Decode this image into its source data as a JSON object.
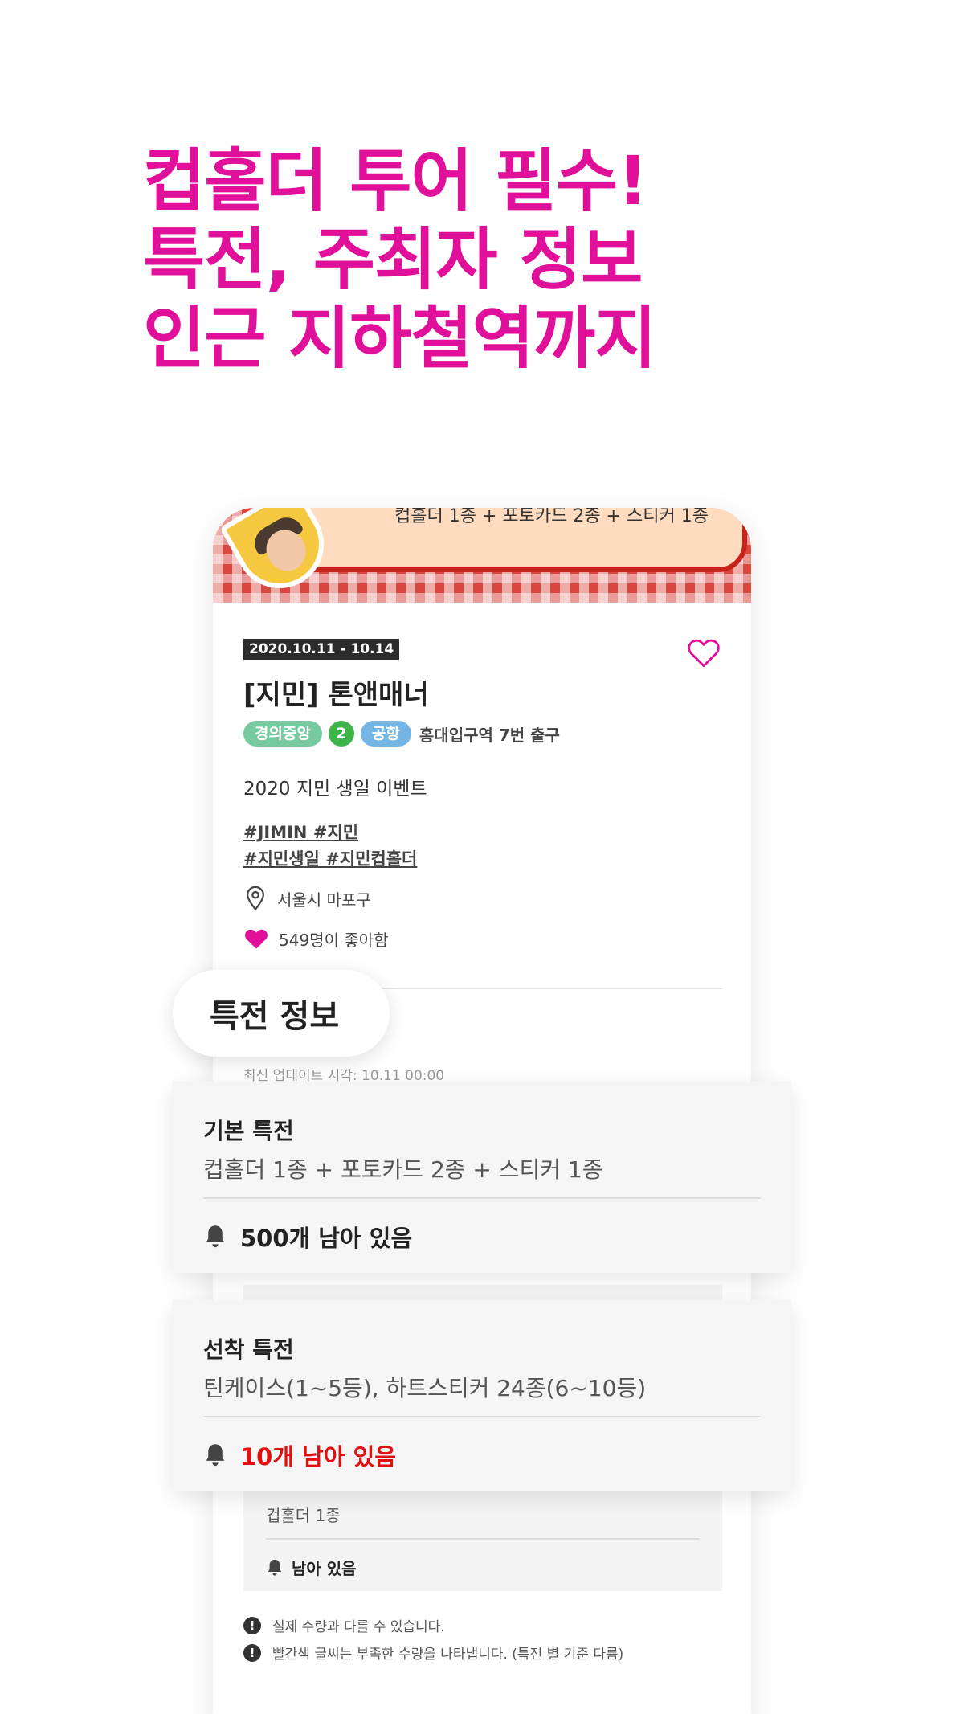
{
  "headline": {
    "lines": [
      "컵홀더 투어 필수!",
      "특전, 주최자 정보",
      "인근 지하철역까지"
    ],
    "color": "#e0109b"
  },
  "banner": {
    "text": "컵홀더 1종 + 포토카드 2종 + 스티커 1종"
  },
  "event": {
    "date_range": "2020.10.11 - 10.14",
    "title": "[지민] 톤앤매너",
    "subway_lines": [
      "경의중앙",
      "2",
      "공항"
    ],
    "station": "홍대입구역 7번 출구",
    "description": "2020 지민 생일 이벤트",
    "hashtags_line1": "#JIMIN #지민",
    "hashtags_line2": "#지민생일 #지민컵홀더",
    "location": "서울시 마포구",
    "likes": "549명이 좋아함"
  },
  "benefits": {
    "section_title": "특전 정보",
    "last_update": "최신 업데이트 시각: 10.11 00:00",
    "basic": {
      "title": "기본 특전",
      "items": "컵홀더 1종 + 포토카드 2종 + 스티커 1종",
      "remaining": "500개 남아 있음"
    },
    "first_come": {
      "title": "선착 특전",
      "items": "틴케이스(1~5등), 하트스티커 24종(6~10등)",
      "remaining": "10개 남아 있음"
    },
    "extra": {
      "items": "컵홀더 1종",
      "remaining": "남아 있음"
    }
  },
  "notes": [
    "실제 수량과 다를 수 있습니다.",
    "빨간색 글씨는 부족한 수량을 나타냅니다. (특전 별 기준 다름)"
  ],
  "colors": {
    "accent": "#e0109b",
    "warning_red": "#e01010",
    "line_gyeongui": "#77c9a0",
    "line_2": "#3cb44a",
    "line_airport": "#73b6e6"
  }
}
